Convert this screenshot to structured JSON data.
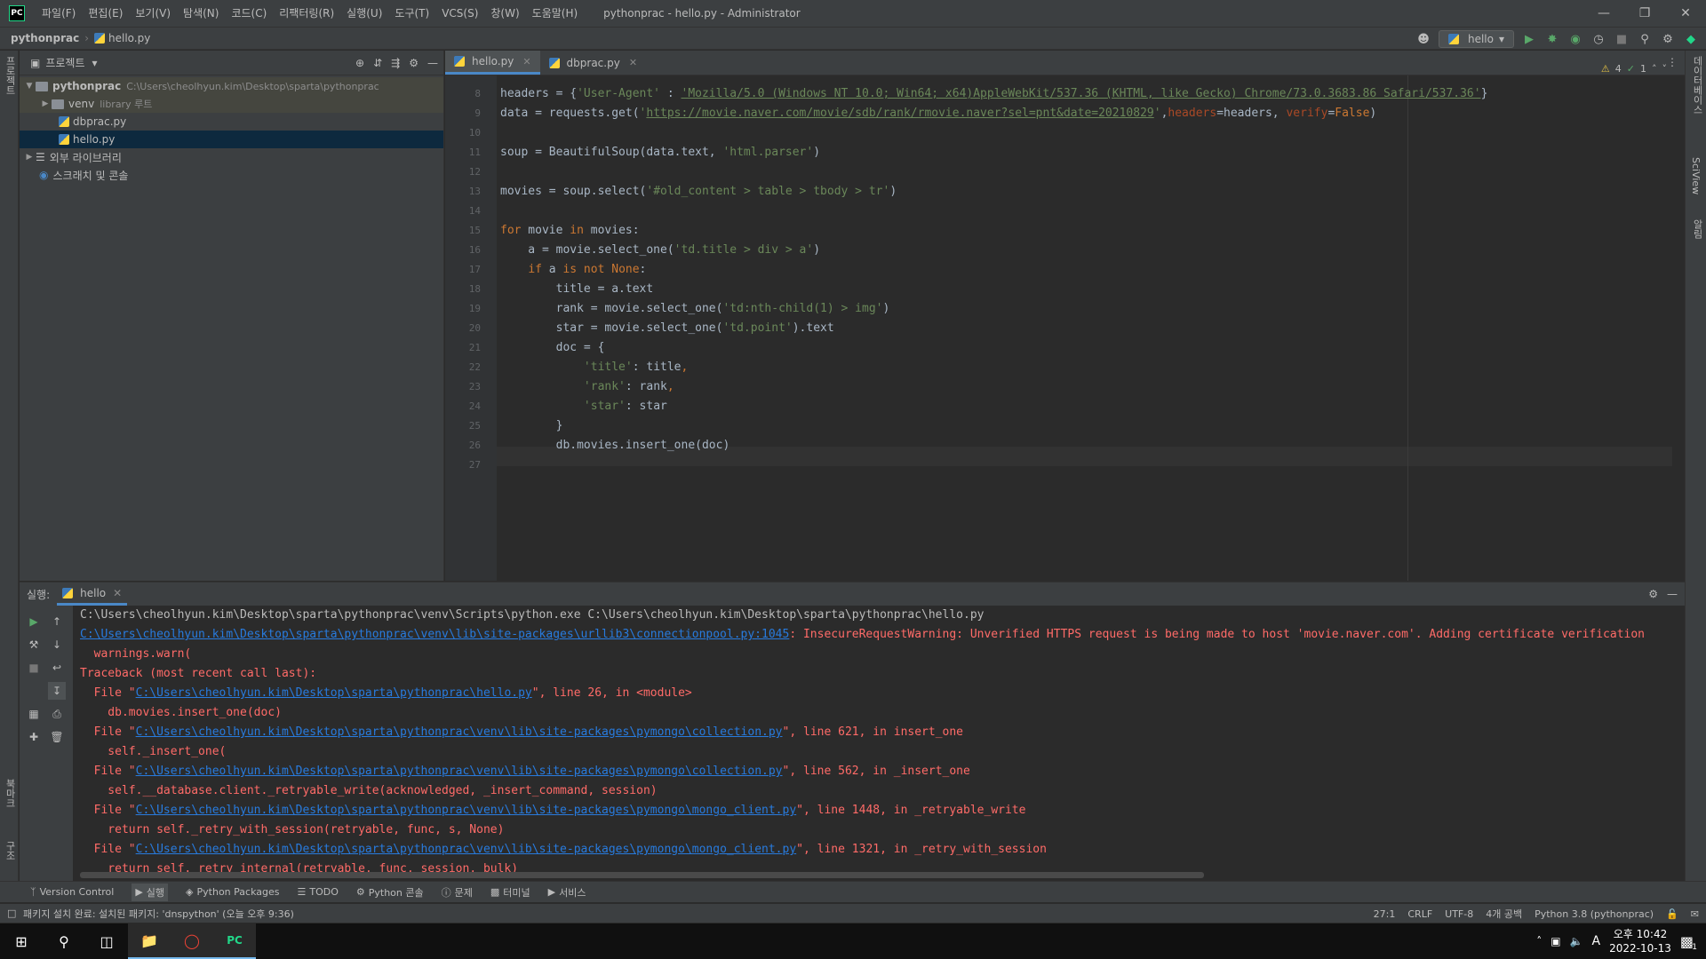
{
  "app": {
    "logo_text": "PC",
    "window_title": "pythonprac - hello.py - Administrator",
    "menu": [
      "파일(F)",
      "편집(E)",
      "보기(V)",
      "탐색(N)",
      "코드(C)",
      "리팩터링(R)",
      "실행(U)",
      "도구(T)",
      "VCS(S)",
      "창(W)",
      "도움말(H)"
    ]
  },
  "navbar": {
    "project": "pythonprac",
    "file": "hello.py",
    "run_config": "hello"
  },
  "left_strip": {
    "project_label": "프로젝트",
    "bookmarks_label": "북마크",
    "structure_label": "구조"
  },
  "right_strip": {
    "database_label": "데이터베이스",
    "sciview_label": "SciView",
    "notifications_label": "알림"
  },
  "project_panel": {
    "title": "프로젝트",
    "tree": [
      {
        "label": "pythonprac",
        "meta": "C:\\Users\\cheolhyun.kim\\Desktop\\sparta\\pythonprac"
      },
      {
        "label": "venv",
        "meta": "library 루트"
      },
      {
        "label": "dbprac.py",
        "meta": ""
      },
      {
        "label": "hello.py",
        "meta": ""
      },
      {
        "label": "외부 라이브러리",
        "meta": ""
      },
      {
        "label": "스크래치 및 콘솔",
        "meta": ""
      }
    ]
  },
  "editor": {
    "tabs": [
      {
        "label": "hello.py",
        "active": true
      },
      {
        "label": "dbprac.py",
        "active": false
      }
    ],
    "inspection": {
      "warnings": "4",
      "ok": "1"
    },
    "line_numbers": [
      "8",
      "9",
      "10",
      "11",
      "12",
      "13",
      "14",
      "15",
      "16",
      "17",
      "18",
      "19",
      "20",
      "21",
      "22",
      "23",
      "24",
      "25",
      "26",
      "27"
    ],
    "lines": [
      [
        [
          "t",
          "headers = {"
        ],
        [
          "s",
          "'User-Agent'"
        ],
        [
          "t",
          " : "
        ],
        [
          "u",
          "'Mozilla/5.0 (Windows NT 10.0; Win64; x64)AppleWebKit/537.36 (KHTML, like Gecko) Chrome/73.0.3683.86 Safari/537.36'"
        ],
        [
          "t",
          "}"
        ]
      ],
      [
        [
          "t",
          "data = requests.get("
        ],
        [
          "s",
          "'"
        ],
        [
          "u",
          "https://movie.naver.com/movie/sdb/rank/rmovie.naver?sel=pnt&date=20210829"
        ],
        [
          "s",
          "'"
        ],
        [
          "t",
          ","
        ],
        [
          "p",
          "headers"
        ],
        [
          "t",
          "=headers, "
        ],
        [
          "p",
          "verify"
        ],
        [
          "t",
          "="
        ],
        [
          "k",
          "False"
        ],
        [
          "t",
          ")"
        ]
      ],
      [],
      [
        [
          "t",
          "soup = BeautifulSoup(data.text, "
        ],
        [
          "s",
          "'html.parser'"
        ],
        [
          "t",
          ")"
        ]
      ],
      [],
      [
        [
          "t",
          "movies = soup.select("
        ],
        [
          "s",
          "'#old_content > table > tbody > tr'"
        ],
        [
          "t",
          ")"
        ]
      ],
      [],
      [
        [
          "k",
          "for"
        ],
        [
          "t",
          " movie "
        ],
        [
          "k",
          "in"
        ],
        [
          "t",
          " movies:"
        ]
      ],
      [
        [
          "t",
          "    a = movie.select_one("
        ],
        [
          "s",
          "'td.title > div > a'"
        ],
        [
          "t",
          ")"
        ]
      ],
      [
        [
          "t",
          "    "
        ],
        [
          "k",
          "if"
        ],
        [
          "t",
          " a "
        ],
        [
          "k",
          "is not None"
        ],
        [
          "t",
          ":"
        ]
      ],
      [
        [
          "t",
          "        title = a.text"
        ]
      ],
      [
        [
          "t",
          "        rank = movie.select_one("
        ],
        [
          "s",
          "'td:nth-child(1) > img'"
        ],
        [
          "t",
          ")"
        ]
      ],
      [
        [
          "t",
          "        star = movie.select_one("
        ],
        [
          "s",
          "'td.point'"
        ],
        [
          "t",
          ").text"
        ]
      ],
      [
        [
          "t",
          "        doc = {"
        ]
      ],
      [
        [
          "t",
          "            "
        ],
        [
          "s",
          "'title'"
        ],
        [
          "t",
          ": title"
        ],
        [
          "k",
          ","
        ]
      ],
      [
        [
          "t",
          "            "
        ],
        [
          "s",
          "'rank'"
        ],
        [
          "t",
          ": rank"
        ],
        [
          "k",
          ","
        ]
      ],
      [
        [
          "t",
          "            "
        ],
        [
          "s",
          "'star'"
        ],
        [
          "t",
          ": star"
        ]
      ],
      [
        [
          "t",
          "        }"
        ]
      ],
      [
        [
          "t",
          "        db.movies.insert_one(doc)"
        ]
      ],
      []
    ]
  },
  "run_panel": {
    "label": "실행:",
    "tab": "hello",
    "console": [
      [
        [
          "n",
          "C:\\Users\\cheolhyun.kim\\Desktop\\sparta\\pythonprac\\venv\\Scripts\\python.exe C:\\Users\\cheolhyun.kim\\Desktop\\sparta\\pythonprac\\hello.py"
        ]
      ],
      [
        [
          "l",
          "C:\\Users\\cheolhyun.kim\\Desktop\\sparta\\pythonprac\\venv\\lib\\site-packages\\urllib3\\connectionpool.py:1045"
        ],
        [
          "e",
          ": InsecureRequestWarning: Unverified HTTPS request is being made to host 'movie.naver.com'. Adding certificate verification"
        ]
      ],
      [
        [
          "e",
          "  warnings.warn("
        ]
      ],
      [
        [
          "e",
          "Traceback (most recent call last):"
        ]
      ],
      [
        [
          "e",
          "  File \""
        ],
        [
          "l",
          "C:\\Users\\cheolhyun.kim\\Desktop\\sparta\\pythonprac\\hello.py"
        ],
        [
          "e",
          "\", line 26, in <module>"
        ]
      ],
      [
        [
          "e",
          "    db.movies.insert_one(doc)"
        ]
      ],
      [
        [
          "e",
          "  File \""
        ],
        [
          "l",
          "C:\\Users\\cheolhyun.kim\\Desktop\\sparta\\pythonprac\\venv\\lib\\site-packages\\pymongo\\collection.py"
        ],
        [
          "e",
          "\", line 621, in insert_one"
        ]
      ],
      [
        [
          "e",
          "    self._insert_one("
        ]
      ],
      [
        [
          "e",
          "  File \""
        ],
        [
          "l",
          "C:\\Users\\cheolhyun.kim\\Desktop\\sparta\\pythonprac\\venv\\lib\\site-packages\\pymongo\\collection.py"
        ],
        [
          "e",
          "\", line 562, in _insert_one"
        ]
      ],
      [
        [
          "e",
          "    self.__database.client._retryable_write(acknowledged, _insert_command, session)"
        ]
      ],
      [
        [
          "e",
          "  File \""
        ],
        [
          "l",
          "C:\\Users\\cheolhyun.kim\\Desktop\\sparta\\pythonprac\\venv\\lib\\site-packages\\pymongo\\mongo_client.py"
        ],
        [
          "e",
          "\", line 1448, in _retryable_write"
        ]
      ],
      [
        [
          "e",
          "    return self._retry_with_session(retryable, func, s, None)"
        ]
      ],
      [
        [
          "e",
          "  File \""
        ],
        [
          "l",
          "C:\\Users\\cheolhyun.kim\\Desktop\\sparta\\pythonprac\\venv\\lib\\site-packages\\pymongo\\mongo_client.py"
        ],
        [
          "e",
          "\", line 1321, in _retry_with_session"
        ]
      ],
      [
        [
          "e",
          "    return self._retry_internal(retryable, func, session, bulk)"
        ]
      ]
    ]
  },
  "bottom_tabs": [
    "Version Control",
    "실행",
    "Python Packages",
    "TODO",
    "Python 콘솔",
    "문제",
    "터미널",
    "서비스"
  ],
  "statusbar": {
    "message": "패키지 설치 완료: 설치된 패키지: 'dnspython' (오늘 오후 9:36)",
    "position": "27:1",
    "line_sep": "CRLF",
    "encoding": "UTF-8",
    "indent": "4개 공백",
    "interpreter": "Python 3.8 (pythonprac)"
  },
  "taskbar": {
    "ime": "A",
    "time": "오후 10:42",
    "date": "2022-10-13",
    "notification_count": "1"
  },
  "colors": {
    "keyword": "#cc7832",
    "string": "#6a8759",
    "error": "#ff6b68",
    "link": "#287bde",
    "param": "#aa4926"
  }
}
